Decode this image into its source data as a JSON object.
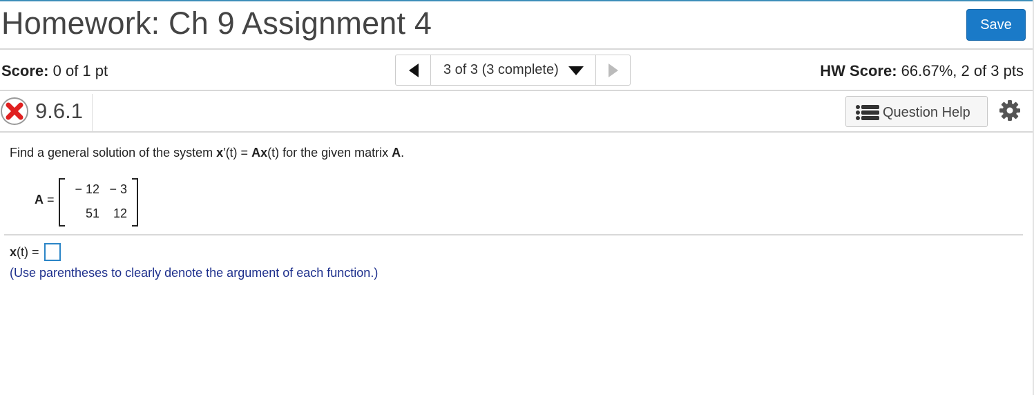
{
  "header": {
    "title": "Homework: Ch 9 Assignment 4",
    "save_label": "Save"
  },
  "scorebar": {
    "score_label": "Score:",
    "score_value": "0 of 1 pt",
    "nav_label": "3 of 3 (3 complete)",
    "hw_score_label": "HW Score:",
    "hw_score_value": "66.67%, 2 of 3 pts"
  },
  "question_bar": {
    "number": "9.6.1",
    "status": "incorrect",
    "help_label": "Question Help"
  },
  "question": {
    "text_1": "Find a general solution of the system ",
    "x_bold": "x",
    "prime": "′(t) = ",
    "A_bold": "A",
    "x_bold2": "x",
    "text_2": "(t) for the given matrix ",
    "A_bold2": "A",
    "text_3": "."
  },
  "matrix": {
    "label_bold": "A",
    "label_eq": " =",
    "rows": [
      [
        "− 12",
        "− 3"
      ],
      [
        "51",
        "12"
      ]
    ]
  },
  "answer": {
    "label_bold": "x",
    "label_rest": "(t) =",
    "value": "",
    "hint": "(Use parentheses to clearly denote the argument of each function.)"
  },
  "colors": {
    "accent": "#1a7ac8",
    "hint": "#1d2f8c",
    "error": "#e02020"
  }
}
